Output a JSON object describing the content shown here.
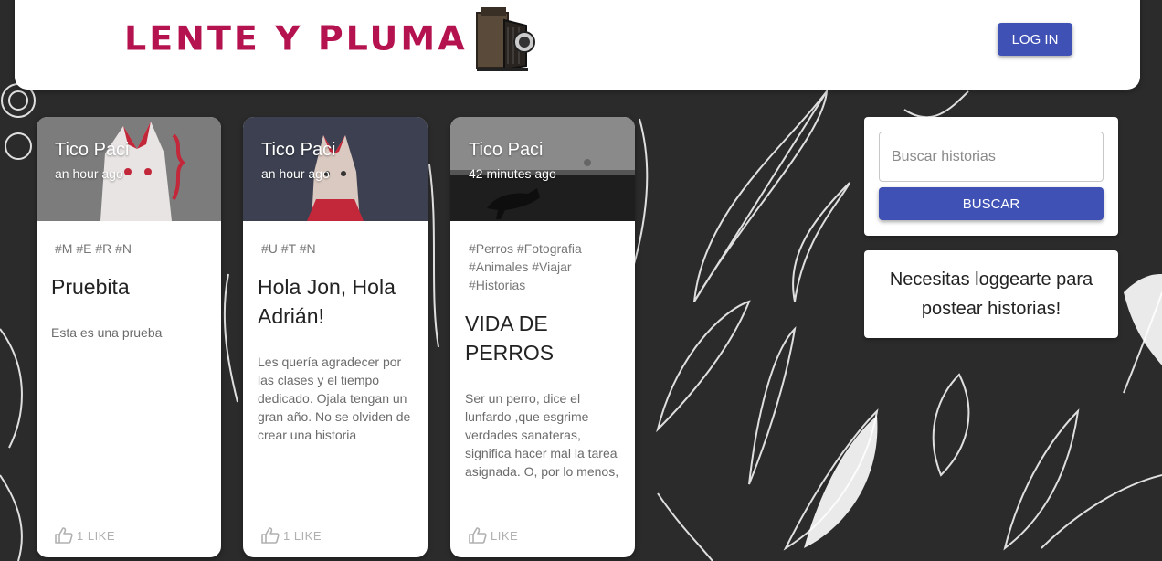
{
  "header": {
    "logo_text": "LENTE Y PLUMA",
    "login_label": "LOG IN"
  },
  "cards": [
    {
      "author": "Tico Paci",
      "time": "an hour ago",
      "tags": "#M #E #R #N",
      "title": "Pruebita",
      "text": "Esta es una prueba",
      "like_label": "1 LIKE"
    },
    {
      "author": "Tico Paci",
      "time": "an hour ago",
      "tags": "#U #T #N",
      "title": "Hola Jon, Hola Adrián!",
      "text": "Les quería agradecer por las clases y el tiempo dedicado. Ojala tengan un gran año. No se olviden de crear una historia",
      "like_label": "1 LIKE"
    },
    {
      "author": "Tico Paci",
      "time": "42 minutes ago",
      "tags": "#Perros #Fotografia #Animales #Viajar #Historias",
      "title": "VIDA DE PERROS",
      "text": "Ser un perro, dice el lunfardo ,que esgrime verdades sanateras, significa hacer mal la tarea asignada. O, por lo menos,",
      "like_label": "LIKE"
    }
  ],
  "search": {
    "placeholder": "Buscar historias",
    "button_label": "BUSCAR"
  },
  "login_notice": "Necesitas loggearte para postear historias!",
  "colors": {
    "brand": "#b5134f",
    "primary": "#3f51b5",
    "background": "#2b2b2b"
  }
}
